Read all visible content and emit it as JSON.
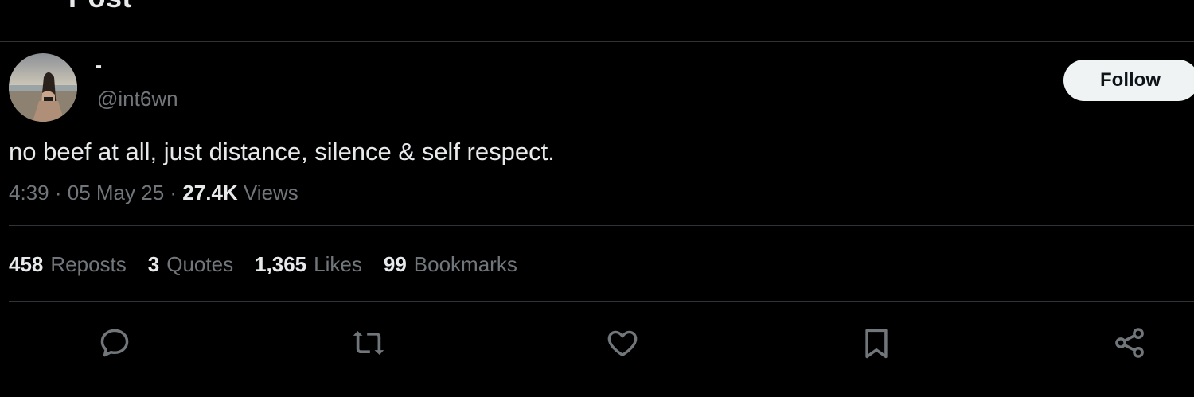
{
  "header": {
    "title": "Post"
  },
  "author": {
    "display_name": "-",
    "handle": "@int6wn",
    "avatar_icon": "profile-photo-beach"
  },
  "follow_button": {
    "label": "Follow"
  },
  "tweet": {
    "text": "no beef at all, just distance, silence & self respect.",
    "time": "4:39",
    "separator": "·",
    "date": "05 May 25",
    "views_count": "27.4K",
    "views_label": "Views"
  },
  "stats": {
    "reposts": {
      "count": "458",
      "label": "Reposts"
    },
    "quotes": {
      "count": "3",
      "label": "Quotes"
    },
    "likes": {
      "count": "1,365",
      "label": "Likes"
    },
    "bookmarks": {
      "count": "99",
      "label": "Bookmarks"
    }
  },
  "actions": {
    "reply": "reply-icon",
    "repost": "repost-icon",
    "like": "heart-icon",
    "bookmark": "bookmark-icon",
    "share": "share-icon"
  },
  "colors": {
    "background": "#000000",
    "text_primary": "#e7e9ea",
    "text_secondary": "#71767b",
    "border": "#2f3336",
    "button_bg": "#eff3f4"
  }
}
